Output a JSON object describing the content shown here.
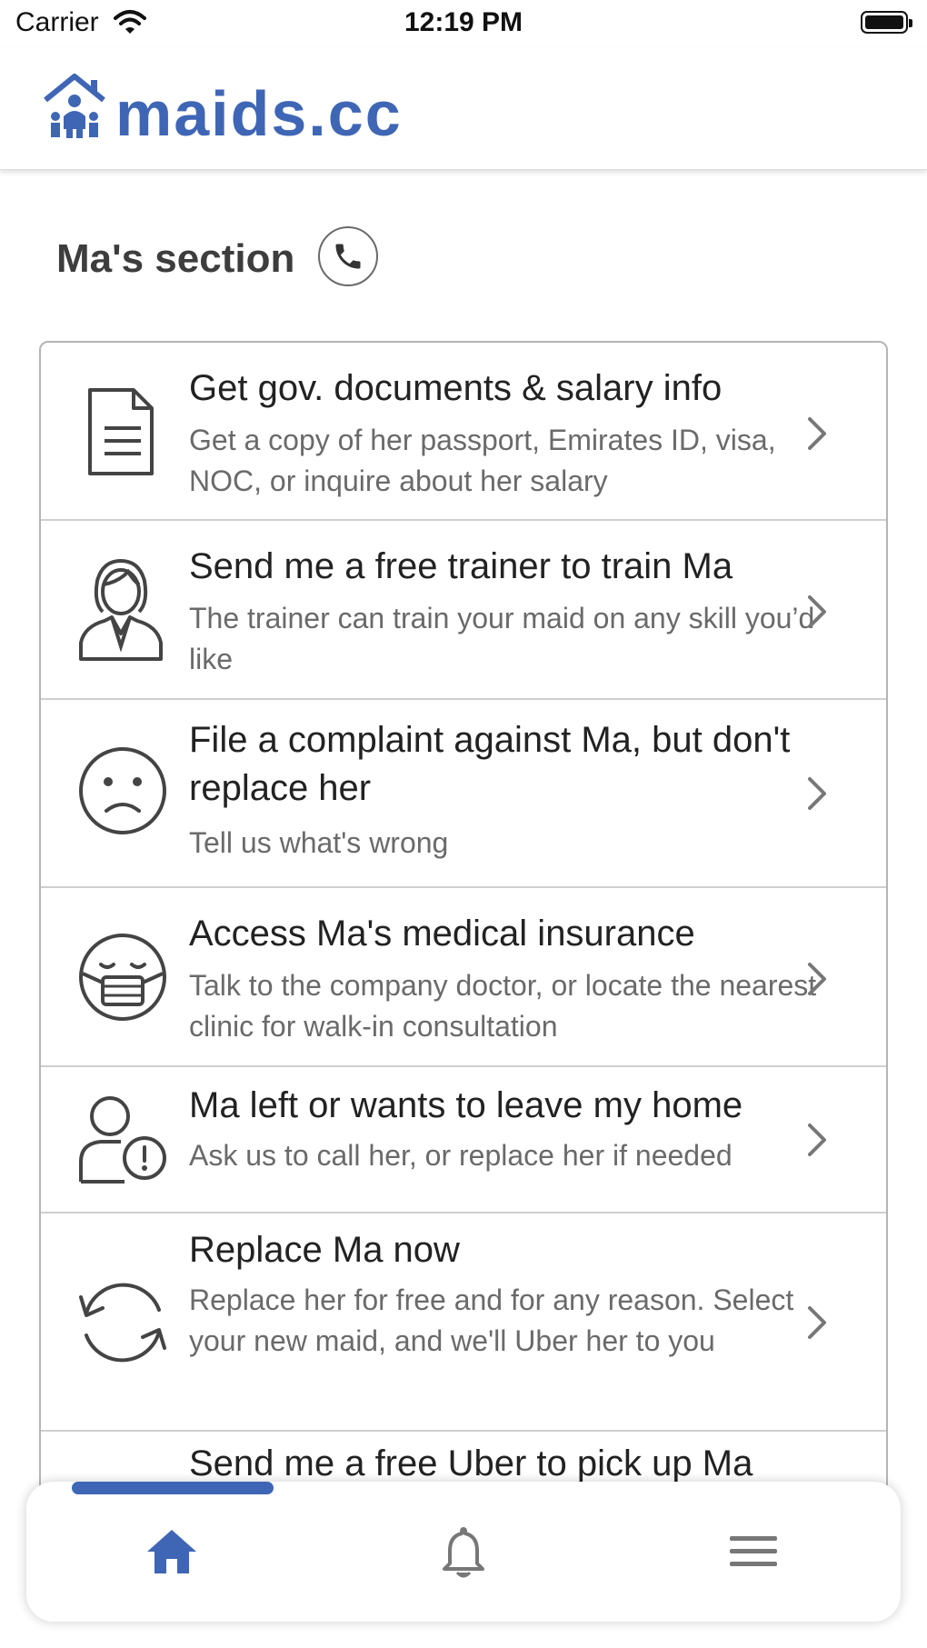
{
  "status_bar": {
    "carrier": "Carrier",
    "time": "12:19 PM"
  },
  "header": {
    "logo_text": "maids.cc"
  },
  "section": {
    "title": "Ma's section"
  },
  "items": [
    {
      "icon": "document-icon",
      "title": "Get gov. documents & salary info",
      "subtitle": "Get a copy of her passport, Emirates ID, visa, NOC, or inquire about her salary"
    },
    {
      "icon": "trainer-icon",
      "title": "Send me a free trainer to train Ma",
      "subtitle": "The trainer can train your maid on any skill you’d like"
    },
    {
      "icon": "sad-face-icon",
      "title": "File a complaint against Ma, but don't replace her",
      "subtitle": "Tell us what's wrong"
    },
    {
      "icon": "medical-mask-icon",
      "title": "Access Ma's medical insurance",
      "subtitle": "Talk to the company doctor, or locate the nearest clinic for walk-in consultation"
    },
    {
      "icon": "user-alert-icon",
      "title": "Ma left or wants to leave my home",
      "subtitle": "Ask us to call her, or replace her if needed"
    },
    {
      "icon": "replace-cycle-icon",
      "title": "Replace Ma now",
      "subtitle": "Replace her for free and for any reason. Select your new maid, and we'll Uber her to you"
    },
    {
      "icon": "",
      "title": "Send me a free Uber to pick up Ma",
      "subtitle": ""
    }
  ],
  "bottom_nav": [
    {
      "icon": "home-icon",
      "active": true
    },
    {
      "icon": "bell-icon",
      "active": false
    },
    {
      "icon": "menu-icon",
      "active": false
    }
  ],
  "colors": {
    "brand": "#3f66b5",
    "icon_gray": "#444444",
    "chevron": "#777777"
  }
}
